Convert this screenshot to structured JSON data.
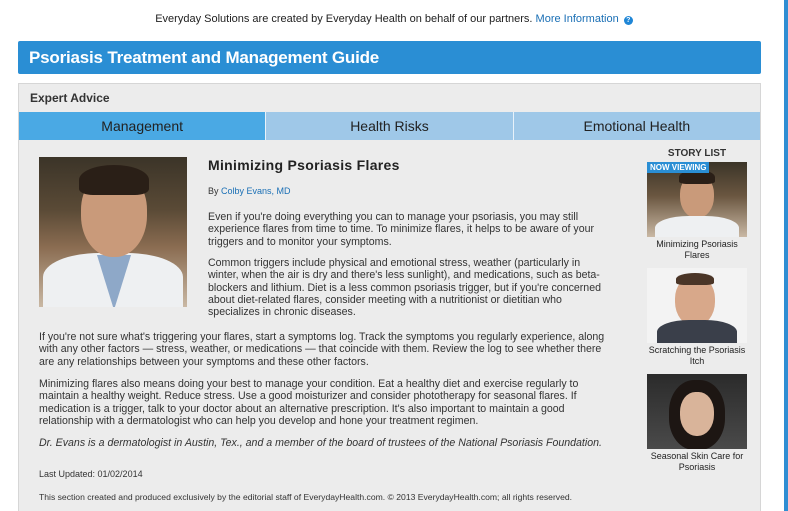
{
  "topbar": {
    "text": "Everyday Solutions are created by Everyday Health on behalf of our partners.",
    "link": "More Information"
  },
  "header": {
    "title": "Psoriasis Treatment and Management Guide"
  },
  "panel": {
    "title": "Expert Advice"
  },
  "tabs": [
    {
      "label": "Management",
      "active": true
    },
    {
      "label": "Health Risks",
      "active": false
    },
    {
      "label": "Emotional Health",
      "active": false
    }
  ],
  "article": {
    "title": "Minimizing Psoriasis Flares",
    "by": "By",
    "author": "Colby Evans, MD",
    "paragraphs": [
      "Even if you're doing everything you can to manage your psoriasis, you may still experience flares from time to time. To minimize flares, it helps to be aware of your triggers and to monitor your symptoms.",
      "Common triggers include physical and emotional stress, weather (particularly in winter, when the air is dry and there's less sunlight), and medications, such as beta-blockers and lithium. Diet is a less common psoriasis trigger, but if you're concerned about diet-related flares, consider meeting with a nutritionist or dietitian who specializes in chronic diseases.",
      "If you're not sure what's triggering your flares, start a symptoms log. Track the symptoms you regularly experience, along with any other factors — stress, weather, or medications — that coincide with them. Review the log to see whether there are any relationships between your symptoms and these other factors.",
      "Minimizing flares also means doing your best to manage your condition. Eat a healthy diet and exercise regularly to maintain a healthy weight. Reduce stress. Use a good moisturizer and consider phototherapy for seasonal flares. If medication is a trigger, talk to your doctor about an alternative prescription. It's also important to maintain a good relationship with a dermatologist who can help you develop and hone your treatment regimen.",
      "Dr. Evans is a dermatologist in Austin, Tex., and a member of the board of trustees of the National Psoriasis Foundation."
    ],
    "last_updated": "Last Updated: 01/02/2014",
    "footer_note": "This section created and produced exclusively by the editorial staff of EverydayHealth.com. © 2013 EverydayHealth.com; all rights reserved."
  },
  "story_list": {
    "title": "STORY LIST",
    "now_viewing": "NOW VIEWING",
    "items": [
      {
        "caption": "Minimizing Psoriasis Flares"
      },
      {
        "caption": "Scratching the Psoriasis Itch"
      },
      {
        "caption": "Seasonal Skin Care for Psoriasis"
      }
    ]
  },
  "colors": {
    "accent": "#2a8ed4",
    "tab_active": "#4aa9e4",
    "tab_inactive": "#9fc8e8",
    "link": "#1a6fb5"
  }
}
